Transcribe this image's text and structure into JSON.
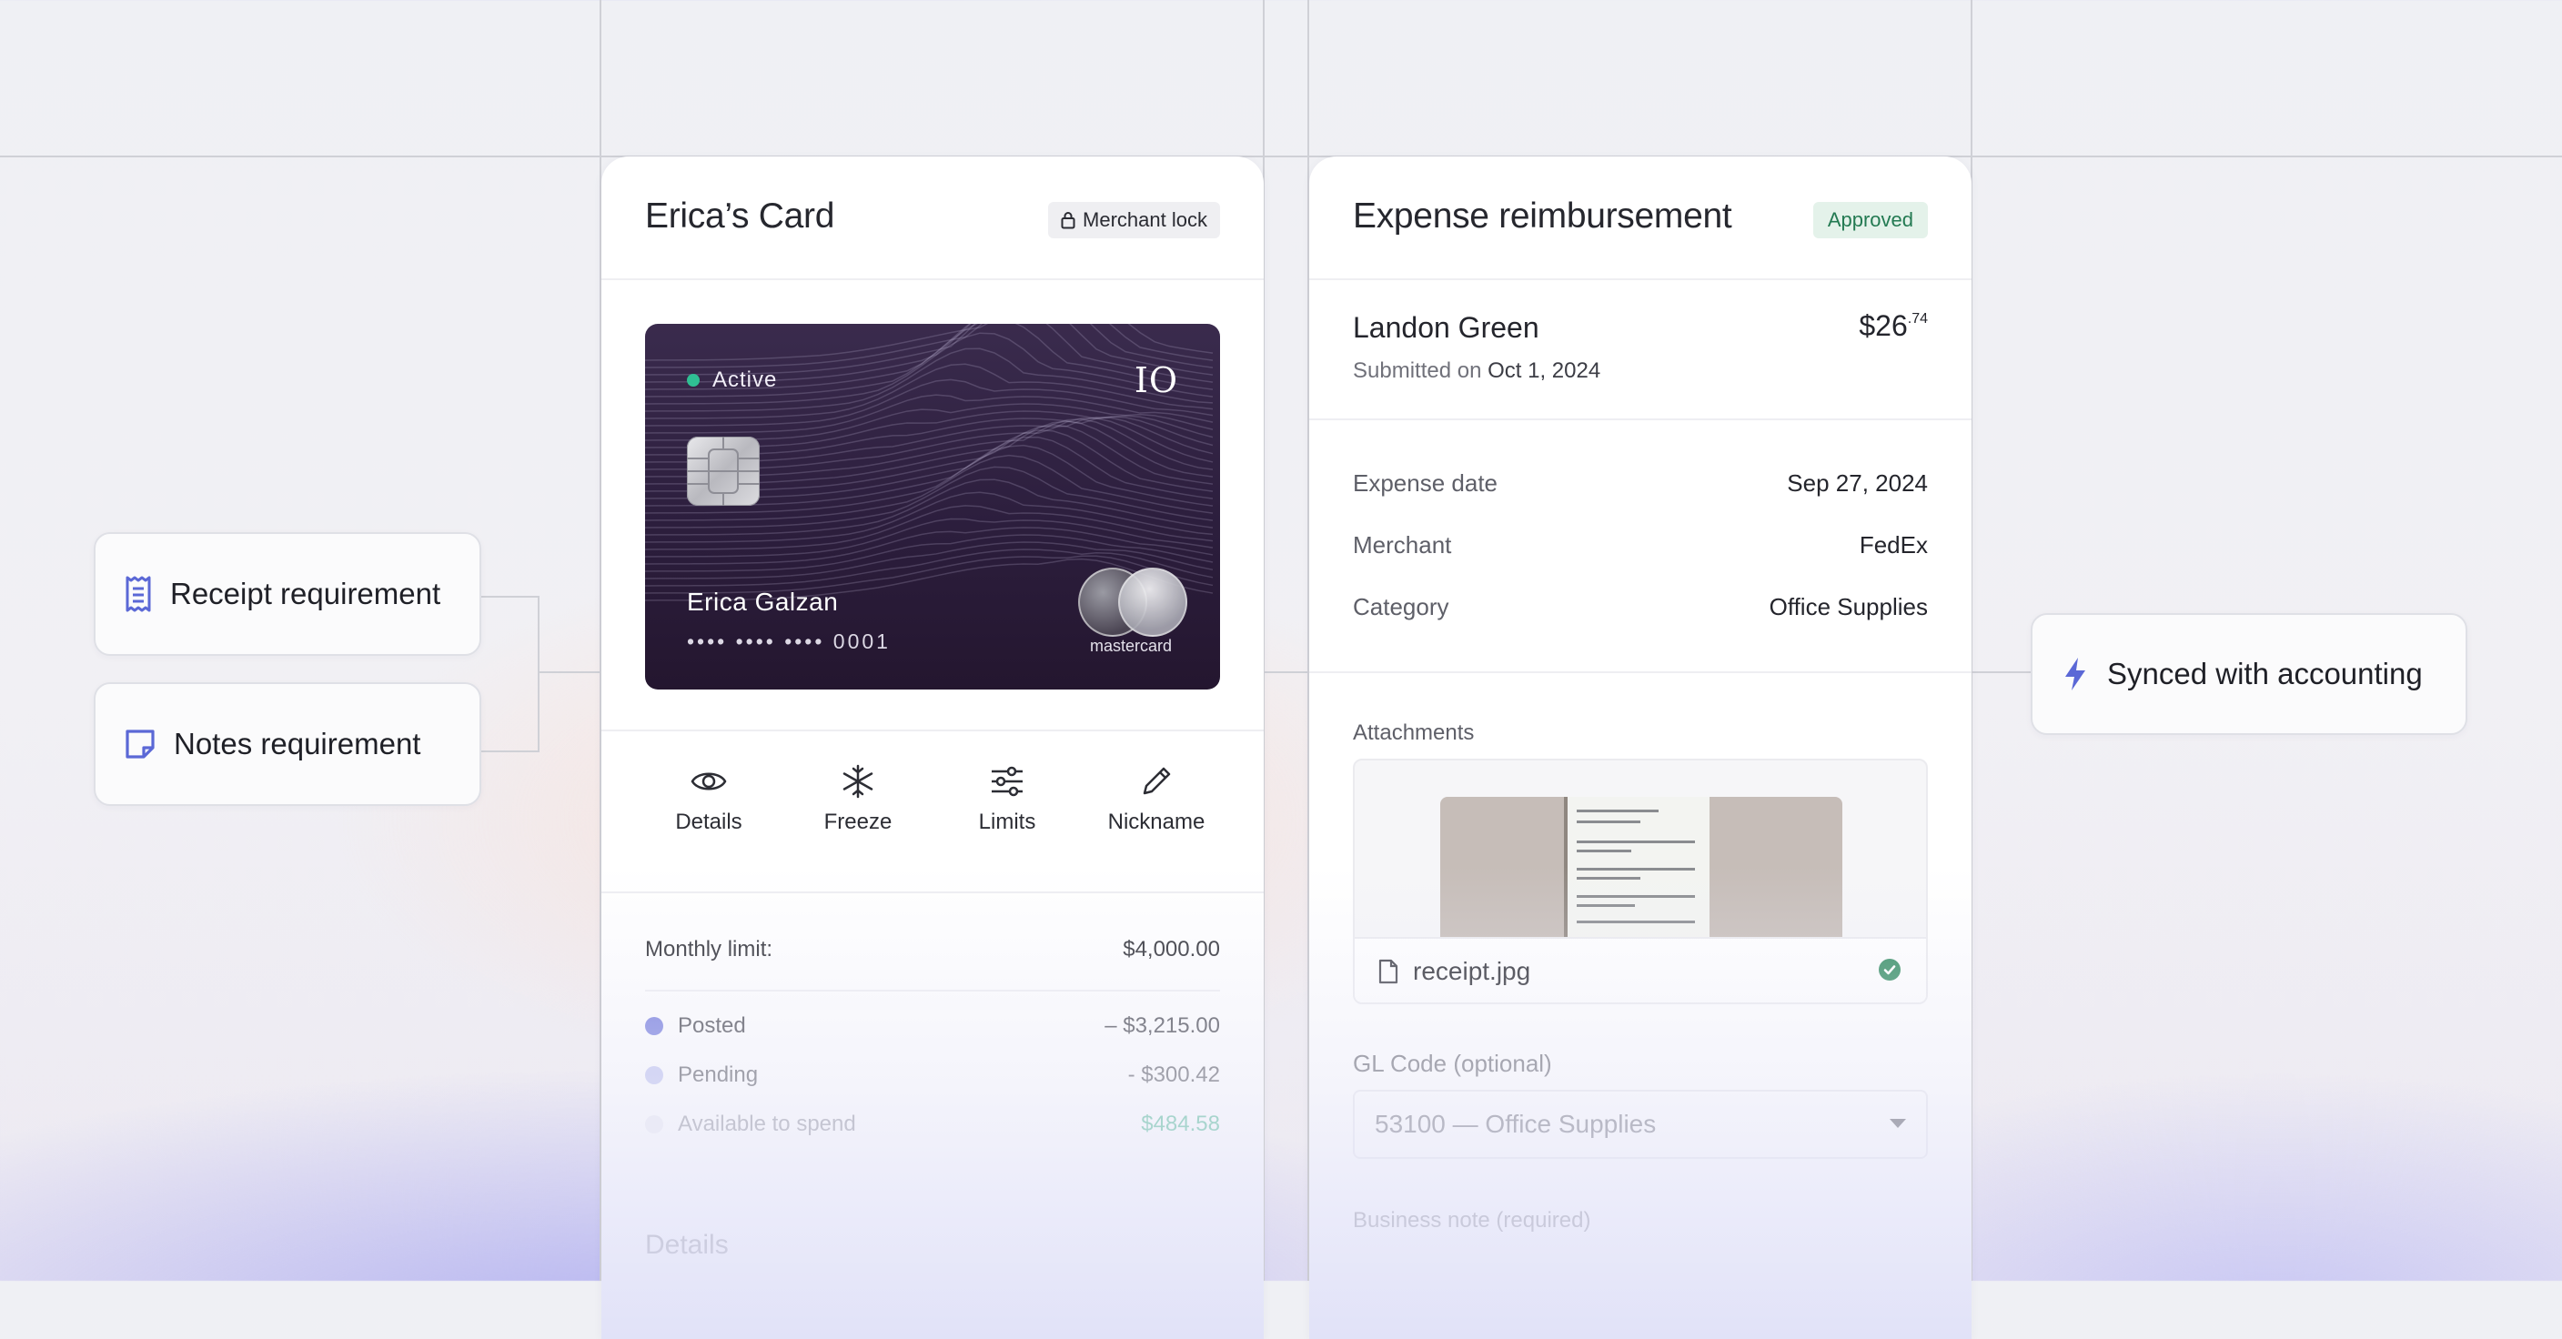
{
  "colors": {
    "accent": "#5b68d6",
    "success": "#2e8a5e",
    "posted": "#6a72db",
    "pending": "#b9bdf0",
    "available": "#3fb489"
  },
  "pills": {
    "receipt": {
      "label": "Receipt requirement",
      "icon": "receipt-icon"
    },
    "notes": {
      "label": "Notes requirement",
      "icon": "note-icon"
    },
    "sync": {
      "label": "Synced with accounting",
      "icon": "lightning-icon"
    }
  },
  "card_panel": {
    "title": "Erica’s Card",
    "badge": "Merchant lock",
    "card": {
      "status": "Active",
      "brand": "IO",
      "holder": "Erica Galzan",
      "number": "•••• •••• •••• 0001",
      "network": "mastercard"
    },
    "actions": [
      {
        "label": "Details",
        "icon": "eye-icon"
      },
      {
        "label": "Freeze",
        "icon": "snowflake-icon"
      },
      {
        "label": "Limits",
        "icon": "sliders-icon"
      },
      {
        "label": "Nickname",
        "icon": "pencil-icon"
      }
    ],
    "monthly_limit": {
      "label": "Monthly limit:",
      "value": "$4,000.00"
    },
    "breakdown": [
      {
        "label": "Posted",
        "value": "– $3,215.00"
      },
      {
        "label": "Pending",
        "value": "- $300.42"
      },
      {
        "label": "Available to spend",
        "value": "$484.58"
      }
    ],
    "details_heading": "Details"
  },
  "expense_panel": {
    "title": "Expense reimbursement",
    "status": "Approved",
    "submitter": "Landon Green",
    "amount_main": "$26",
    "amount_cents": ".74",
    "submitted_prefix": "Submitted on",
    "submitted_date": "Oct 1, 2024",
    "fields": [
      {
        "key": "Expense date",
        "value": "Sep 27, 2024"
      },
      {
        "key": "Merchant",
        "value": "FedEx"
      },
      {
        "key": "Category",
        "value": "Office Supplies"
      }
    ],
    "attachments_label": "Attachments",
    "file_name": "receipt.jpg",
    "gl_label": "GL Code (optional)",
    "gl_value": "53100 — Office Supplies",
    "note_label": "Business note (required)"
  }
}
